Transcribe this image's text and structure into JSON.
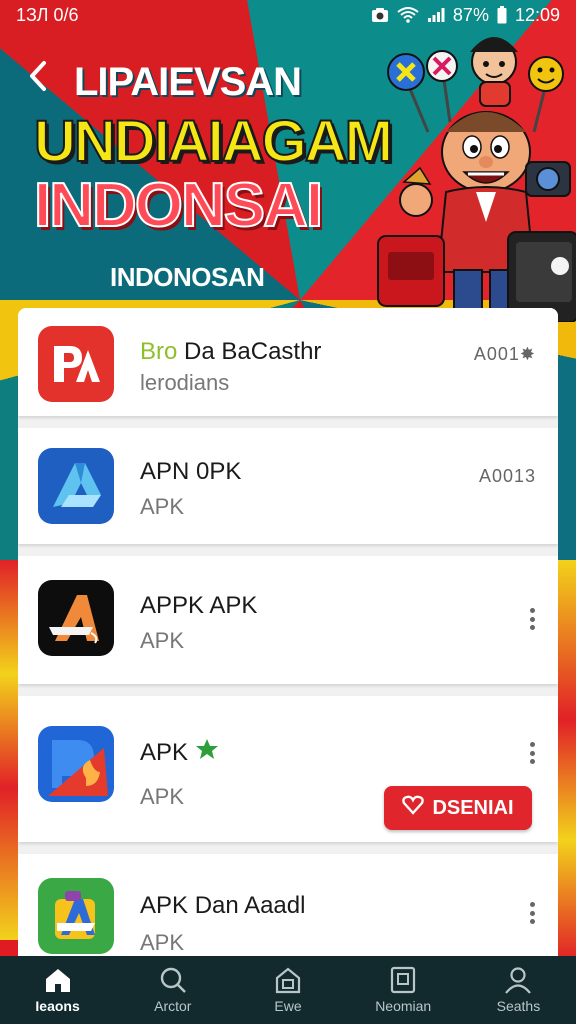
{
  "status_bar": {
    "time_left": "1ЗЛ 0/6",
    "battery": "87%",
    "clock": "12:09"
  },
  "hero": {
    "line1": "LIPAIEVSAN",
    "line2": "UNDIAIAGAM",
    "line3": "INDONSAI",
    "line4": "INDONOSAN"
  },
  "apps": [
    {
      "title_prefix": "Bro",
      "title": "Da BaCasthr",
      "subtitle": "lerodians",
      "code": "A001✸",
      "icon": "red-pa-logo-icon"
    },
    {
      "title": "APN 0PK",
      "subtitle": "APK",
      "code": "A0013",
      "icon": "blue-a-logo-icon"
    },
    {
      "title": "APPK APK",
      "subtitle": "APK",
      "icon": "black-a-logo-icon"
    },
    {
      "title": "APK",
      "subtitle": "APK",
      "icon": "blue-red-logo-icon",
      "badge_icon": "green-star-icon",
      "button_label": "DSENIAI"
    },
    {
      "title": "APK Dan Aaadl",
      "subtitle": "APK",
      "icon": "green-a-logo-icon"
    }
  ],
  "nav": [
    {
      "label": "Ieaons",
      "icon": "home-icon",
      "active": true
    },
    {
      "label": "Arctor",
      "icon": "search-icon",
      "active": false
    },
    {
      "label": "Ewe",
      "icon": "store-icon",
      "active": false
    },
    {
      "label": "Neomian",
      "icon": "square-icon",
      "active": false
    },
    {
      "label": "Seaths",
      "icon": "person-icon",
      "active": false
    }
  ],
  "colors": {
    "accent_red": "#e1252c",
    "nav_bg": "#122a2d",
    "hero_yellow": "#f5e716"
  }
}
